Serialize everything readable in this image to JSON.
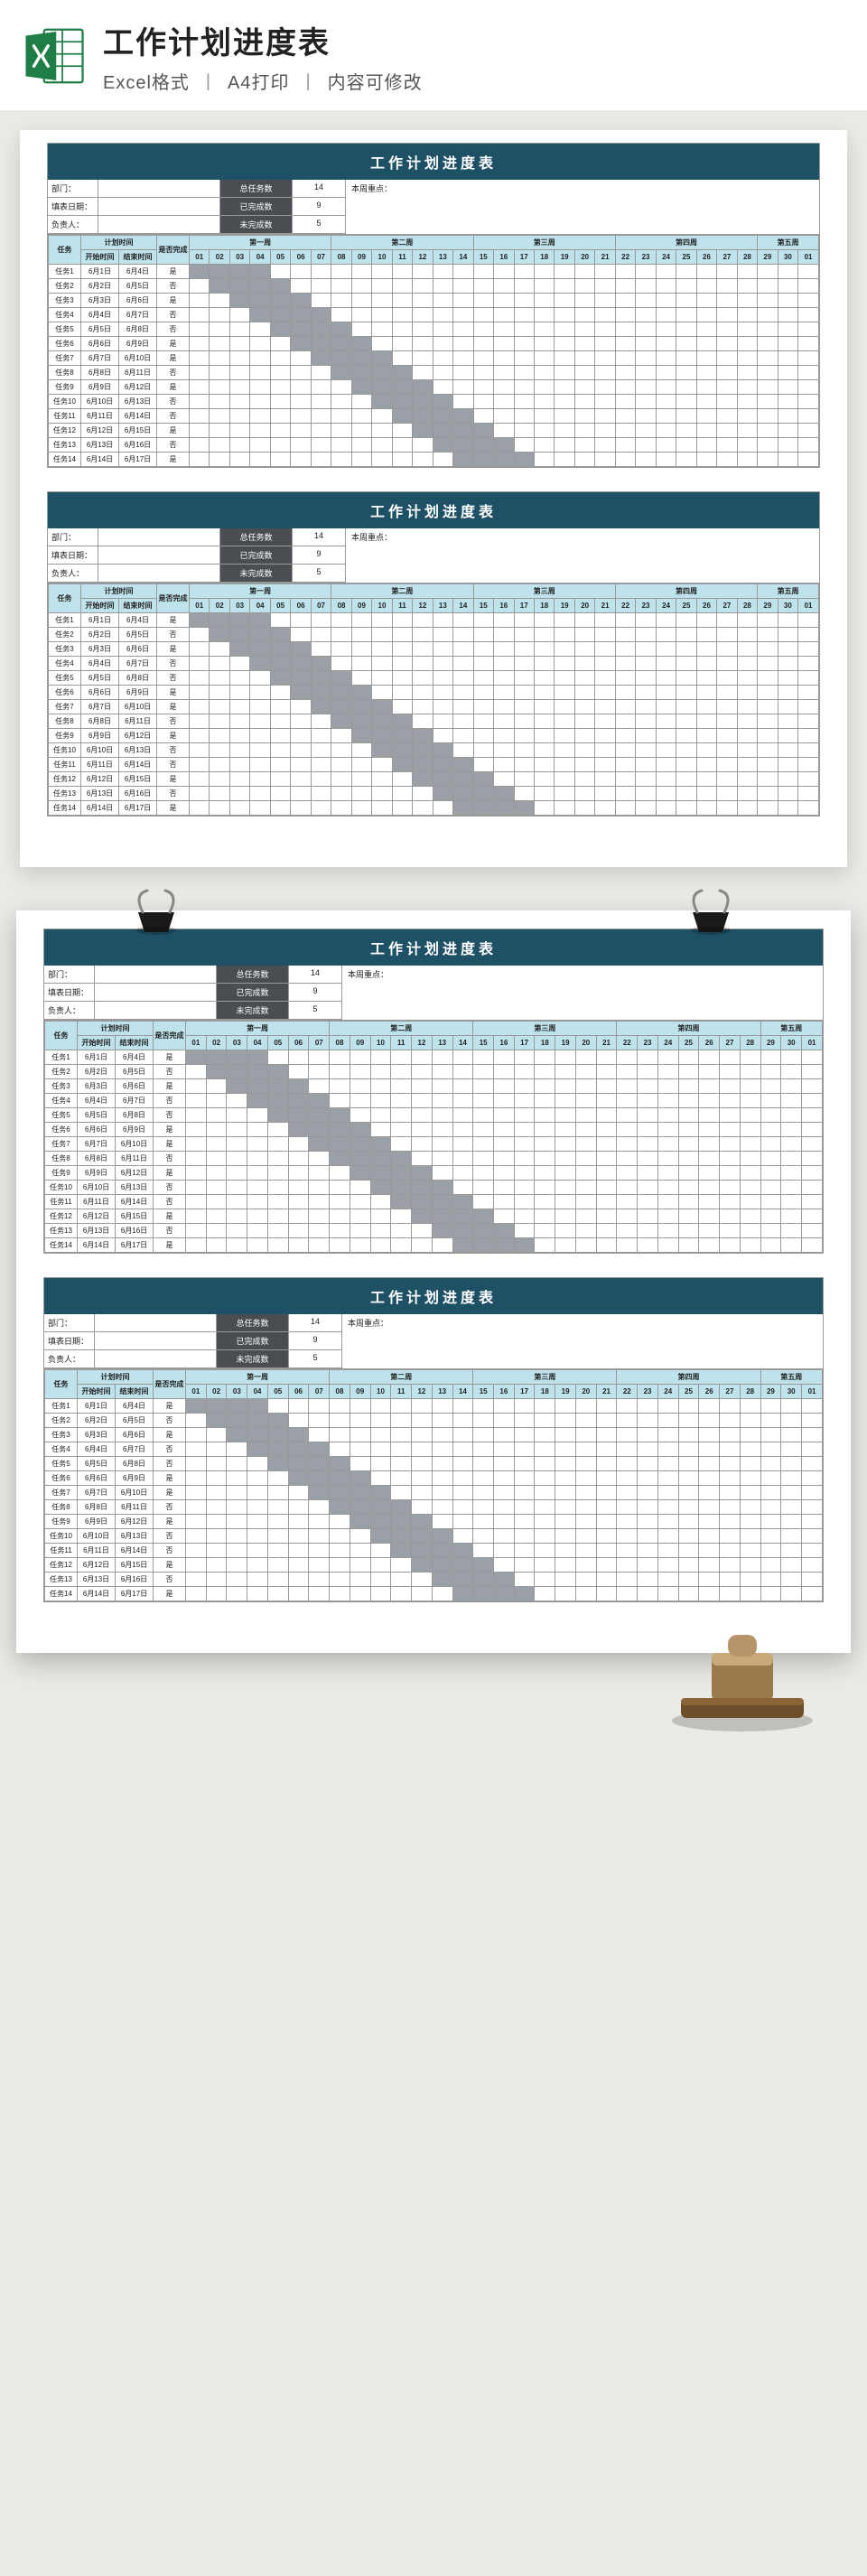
{
  "banner": {
    "title": "工作计划进度表",
    "sub1": "Excel格式",
    "sub2": "A4打印",
    "sub3": "内容可修改"
  },
  "sheet": {
    "title": "工作计划进度表",
    "meta": {
      "dept_label": "部门：",
      "date_label": "填表日期：",
      "owner_label": "负责人：",
      "total_label": "总任务数",
      "total_val": "14",
      "done_label": "已完成数",
      "done_val": "9",
      "undone_label": "未完成数",
      "undone_val": "5",
      "focus_label": "本周重点："
    },
    "headers": {
      "task": "任务",
      "plan_time": "计划时间",
      "start": "开始时间",
      "end": "结束时间",
      "is_done": "是否完成",
      "weeks": [
        "第一周",
        "第二周",
        "第三周",
        "第四周",
        "第五周"
      ],
      "days": [
        "01",
        "02",
        "03",
        "04",
        "05",
        "06",
        "07",
        "08",
        "09",
        "10",
        "11",
        "12",
        "13",
        "14",
        "15",
        "16",
        "17",
        "18",
        "19",
        "20",
        "21",
        "22",
        "23",
        "24",
        "25",
        "26",
        "27",
        "28",
        "29",
        "30",
        "01"
      ]
    },
    "rows": [
      {
        "name": "任务1",
        "start": "6月1日",
        "end": "6月4日",
        "done": "是",
        "bar": [
          1,
          4
        ]
      },
      {
        "name": "任务2",
        "start": "6月2日",
        "end": "6月5日",
        "done": "否",
        "bar": [
          2,
          5
        ]
      },
      {
        "name": "任务3",
        "start": "6月3日",
        "end": "6月6日",
        "done": "是",
        "bar": [
          3,
          6
        ]
      },
      {
        "name": "任务4",
        "start": "6月4日",
        "end": "6月7日",
        "done": "否",
        "bar": [
          4,
          7
        ]
      },
      {
        "name": "任务5",
        "start": "6月5日",
        "end": "6月8日",
        "done": "否",
        "bar": [
          5,
          8
        ]
      },
      {
        "name": "任务6",
        "start": "6月6日",
        "end": "6月9日",
        "done": "是",
        "bar": [
          6,
          9
        ]
      },
      {
        "name": "任务7",
        "start": "6月7日",
        "end": "6月10日",
        "done": "是",
        "bar": [
          7,
          10
        ]
      },
      {
        "name": "任务8",
        "start": "6月8日",
        "end": "6月11日",
        "done": "否",
        "bar": [
          8,
          11
        ]
      },
      {
        "name": "任务9",
        "start": "6月9日",
        "end": "6月12日",
        "done": "是",
        "bar": [
          9,
          12
        ]
      },
      {
        "name": "任务10",
        "start": "6月10日",
        "end": "6月13日",
        "done": "否",
        "bar": [
          10,
          13
        ]
      },
      {
        "name": "任务11",
        "start": "6月11日",
        "end": "6月14日",
        "done": "否",
        "bar": [
          11,
          14
        ]
      },
      {
        "name": "任务12",
        "start": "6月12日",
        "end": "6月15日",
        "done": "是",
        "bar": [
          12,
          15
        ]
      },
      {
        "name": "任务13",
        "start": "6月13日",
        "end": "6月16日",
        "done": "否",
        "bar": [
          13,
          16
        ]
      },
      {
        "name": "任务14",
        "start": "6月14日",
        "end": "6月17日",
        "done": "是",
        "bar": [
          14,
          17
        ]
      }
    ]
  }
}
